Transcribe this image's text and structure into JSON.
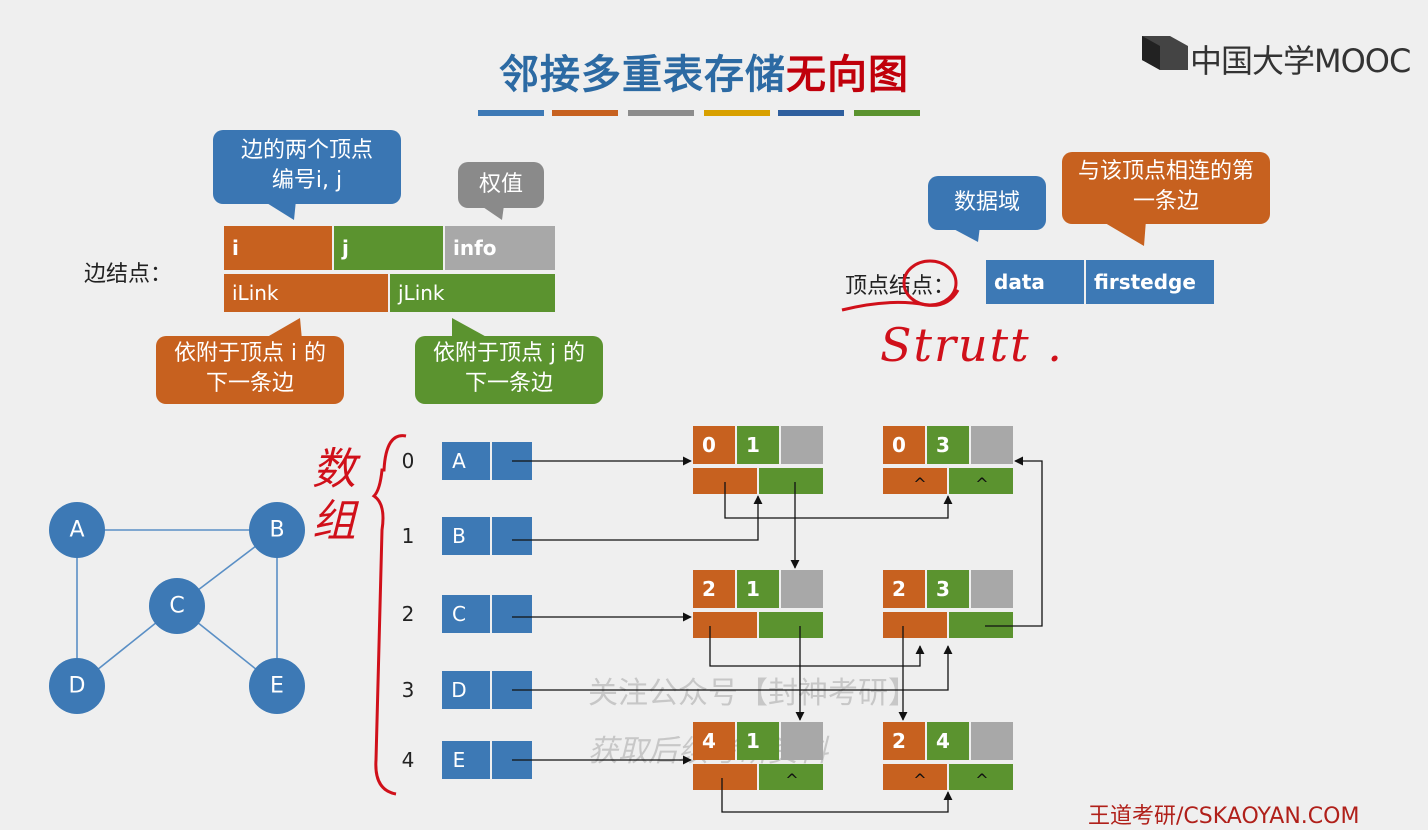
{
  "title": {
    "part1": "邻接多重表存储",
    "part2": "无向图"
  },
  "title_bar_colors": [
    "#3d79b5",
    "#c7611f",
    "#8c8c8c",
    "#d8a000",
    "#2f5f9e",
    "#5b932f"
  ],
  "logo": {
    "text": "中国大学MOOC",
    "icon": "mooc-logo-icon"
  },
  "edge_node": {
    "label": "边结点：",
    "fields_row1": [
      "i",
      "j",
      "info"
    ],
    "fields_row2": [
      "iLink",
      "jLink"
    ],
    "callout_ij": "边的两个顶点编号i, j",
    "callout_info": "权值",
    "callout_ilink": "依附于顶点 i 的下一条边",
    "callout_jlink": "依附于顶点 j 的下一条边"
  },
  "vertex_node": {
    "label": "顶点结点：",
    "fields": [
      "data",
      "firstedge"
    ],
    "callout_data": "数据域",
    "callout_firstedge": "与该顶点相连的第一条边"
  },
  "handwriting": {
    "struct": "Strutt .",
    "array": "数组"
  },
  "graph": {
    "nodes": [
      "A",
      "B",
      "C",
      "D",
      "E"
    ]
  },
  "vertex_array": {
    "indices": [
      "0",
      "1",
      "2",
      "3",
      "4"
    ],
    "vertices": [
      "A",
      "B",
      "C",
      "D",
      "E"
    ]
  },
  "edges": [
    {
      "i": "0",
      "j": "1",
      "ilink": "",
      "jlink": ""
    },
    {
      "i": "0",
      "j": "3",
      "ilink": "^",
      "jlink": "^"
    },
    {
      "i": "2",
      "j": "1",
      "ilink": "",
      "jlink": ""
    },
    {
      "i": "2",
      "j": "3",
      "ilink": "",
      "jlink": ""
    },
    {
      "i": "4",
      "j": "1",
      "ilink": "",
      "jlink": "^"
    },
    {
      "i": "2",
      "j": "4",
      "ilink": "^",
      "jlink": "^"
    }
  ],
  "watermark": {
    "line1": "关注公众号【封神考研】",
    "line2": "获取后续考研资料"
  },
  "footer": "王道考研/CSKAOYAN.COM",
  "colors": {
    "orange": "#c7611f",
    "green": "#5b932f",
    "gray": "#a8a8a8",
    "blue": "#3d79b5",
    "blue_dark": "#3170ac",
    "hand_red": "#d0101a"
  }
}
